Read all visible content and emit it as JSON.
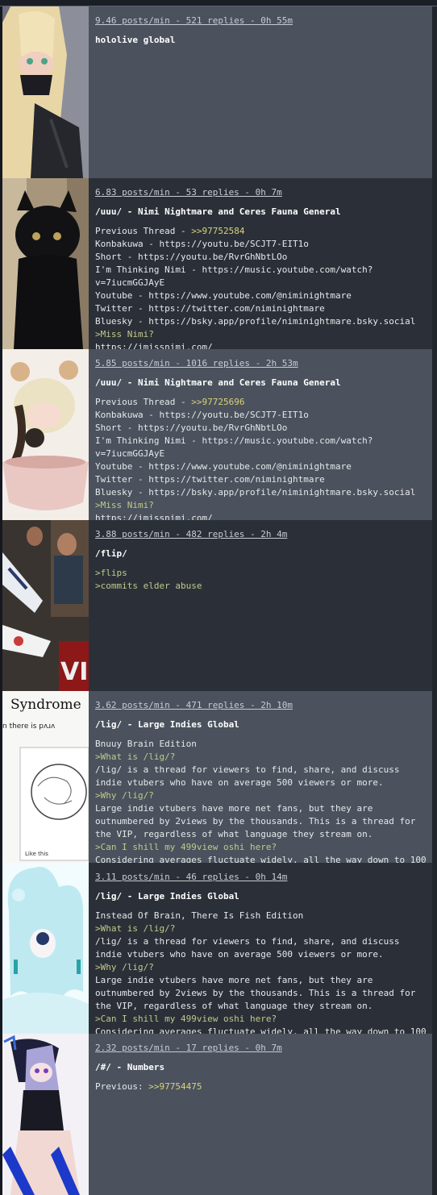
{
  "threads": [
    {
      "stats": "9.46 posts/min - 521 replies - 0h 55m",
      "title": "hololive global",
      "lines": []
    },
    {
      "stats": "6.83 posts/min - 53 replies - 0h 7m",
      "title": "/uuu/ - Nimi Nightmare and Ceres Fauna General",
      "lines": [
        {
          "text": "Previous Thread - ",
          "link": ">>97752584"
        },
        {
          "text": "Konbakuwa - https://youtu.be/SCJT7-EIT1o"
        },
        {
          "text": "Short - https://youtu.be/RvrGhNbtLOo"
        },
        {
          "text": "I'm Thinking Nimi - https://music.youtube.com/watch?v=7iucmGGJAyE"
        },
        {
          "text": "Youtube - https://www.youtube.com/@niminightmare"
        },
        {
          "text": "Twitter - https://twitter.com/niminightmare"
        },
        {
          "text": "Bluesky - https://bsky.app/profile/niminightmare.bsky.social"
        },
        {
          "text": ">Miss Nimi?",
          "green": true
        },
        {
          "text": "https://imissnimi.com/"
        }
      ]
    },
    {
      "stats": "5.85 posts/min - 1016 replies - 2h 53m",
      "title": "/uuu/ - Nimi Nightmare and Ceres Fauna General",
      "lines": [
        {
          "text": "Previous Thread - ",
          "link": ">>97725696"
        },
        {
          "text": "Konbakuwa - https://youtu.be/SCJT7-EIT1o"
        },
        {
          "text": "Short - https://youtu.be/RvrGhNbtLOo"
        },
        {
          "text": "I'm Thinking Nimi - https://music.youtube.com/watch?v=7iucmGGJAyE"
        },
        {
          "text": "Youtube - https://www.youtube.com/@niminightmare"
        },
        {
          "text": "Twitter - https://twitter.com/niminightmare"
        },
        {
          "text": "Bluesky - https://bsky.app/profile/niminightmare.bsky.social"
        },
        {
          "text": ">Miss Nimi?",
          "green": true
        },
        {
          "text": "https://imissnimi.com/"
        }
      ]
    },
    {
      "stats": "3.88 posts/min - 482 replies - 2h 4m",
      "title": "/flip/",
      "lines": [
        {
          "text": ">flips",
          "green": true
        },
        {
          "text": ">commits elder abuse",
          "green": true
        }
      ]
    },
    {
      "stats": "3.62 posts/min - 471 replies - 2h 10m",
      "title": "/lig/ - Large Indies Global",
      "lines": [
        {
          "text": "Bnuuy Brain Edition"
        },
        {
          "text": ">What is /lig/?",
          "green": true
        },
        {
          "text": "/lig/ is a thread for viewers to find, share, and discuss indie vtubers who have on average 500 viewers or more."
        },
        {
          "text": ">Why /lig/?",
          "green": true
        },
        {
          "text": "Large indie vtubers have more net fans, but they are outnumbered by 2views by the thousands. This is a thread for the VIP, regardless of what language they stream on."
        },
        {
          "text": ">Can I shill my 499view oshi here?",
          "green": true
        },
        {
          "text": "Considering averages fluctuate widely, all the way down to 100"
        }
      ]
    },
    {
      "stats": "3.11 posts/min - 46 replies - 0h 14m",
      "title": "/lig/ - Large Indies Global",
      "lines": [
        {
          "text": "Instead Of Brain, There Is Fish Edition"
        },
        {
          "text": ">What is /lig/?",
          "green": true
        },
        {
          "text": "/lig/ is a thread for viewers to find, share, and discuss indie vtubers who have on average 500 viewers or more."
        },
        {
          "text": ">Why /lig/?",
          "green": true
        },
        {
          "text": "Large indie vtubers have more net fans, but they are outnumbered by 2views by the thousands. This is a thread for the VIP, regardless of what language they stream on."
        },
        {
          "text": ">Can I shill my 499view oshi here?",
          "green": true
        },
        {
          "text": "Considering averages fluctuate widely, all the way down to 100"
        }
      ]
    },
    {
      "stats": "2.32 posts/min - 17 replies - 0h 7m",
      "title": "/#/ - Numbers",
      "lines": [
        {
          "text": "Previous: ",
          "link": ">>97754475"
        }
      ]
    }
  ],
  "thumbnail_text": {
    "t5_heading": "Syndrome",
    "t5_sub": "n there is pʌɹʌ",
    "t5_caption": "Like this",
    "t4_sign": "VI"
  }
}
